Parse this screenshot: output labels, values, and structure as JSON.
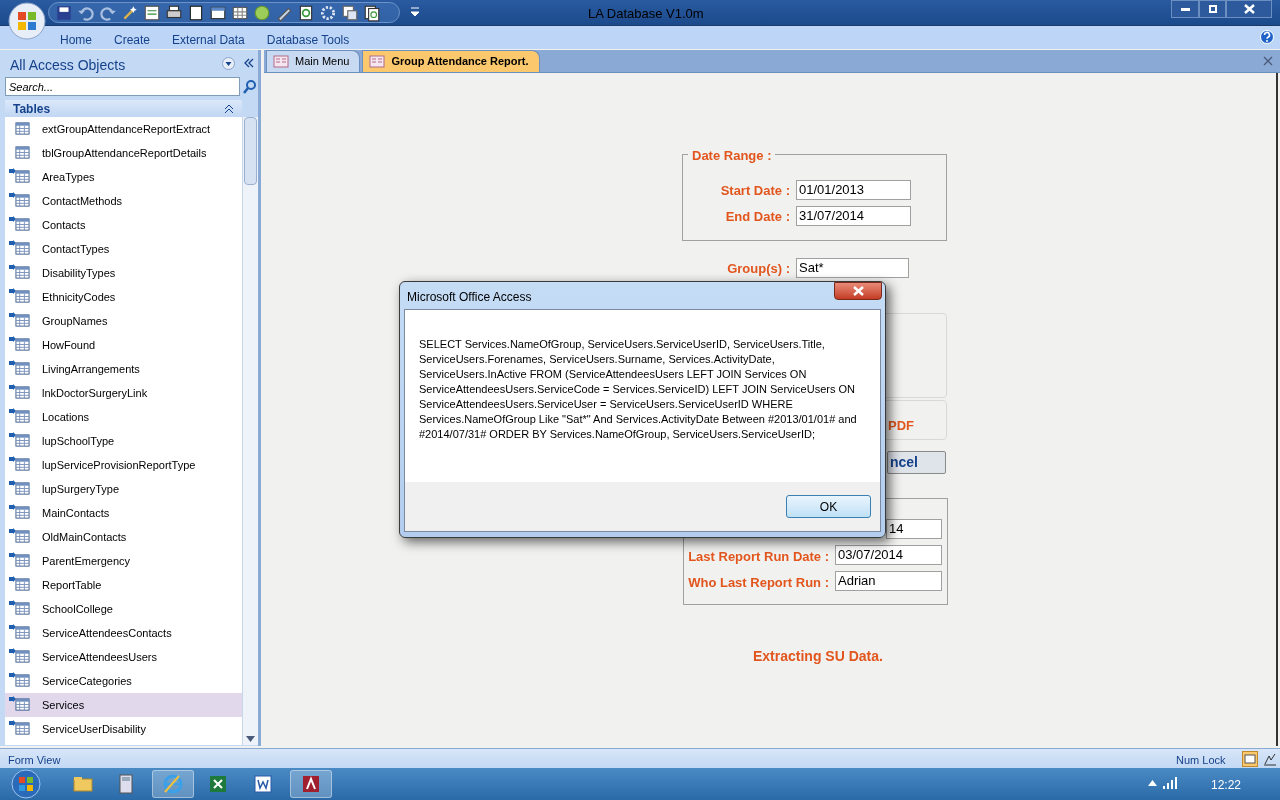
{
  "window": {
    "title": "LA Database V1.0m"
  },
  "ribbon_tabs": [
    "Home",
    "Create",
    "External Data",
    "Database Tools"
  ],
  "nav_pane": {
    "title": "All Access Objects",
    "search": {
      "placeholder": "Search..."
    },
    "group": "Tables",
    "items": [
      {
        "label": "extGroupAttendanceReportExtract",
        "kind": "local",
        "selected": false
      },
      {
        "label": "tblGroupAttendanceReportDetails",
        "kind": "local",
        "selected": false
      },
      {
        "label": "AreaTypes",
        "kind": "linked",
        "selected": false
      },
      {
        "label": "ContactMethods",
        "kind": "linked",
        "selected": false
      },
      {
        "label": "Contacts",
        "kind": "linked",
        "selected": false
      },
      {
        "label": "ContactTypes",
        "kind": "linked",
        "selected": false
      },
      {
        "label": "DisabilityTypes",
        "kind": "linked",
        "selected": false
      },
      {
        "label": "EthnicityCodes",
        "kind": "linked",
        "selected": false
      },
      {
        "label": "GroupNames",
        "kind": "linked",
        "selected": false
      },
      {
        "label": "HowFound",
        "kind": "linked",
        "selected": false
      },
      {
        "label": "LivingArrangements",
        "kind": "linked",
        "selected": false
      },
      {
        "label": "lnkDoctorSurgeryLink",
        "kind": "linked",
        "selected": false
      },
      {
        "label": "Locations",
        "kind": "linked",
        "selected": false
      },
      {
        "label": "lupSchoolType",
        "kind": "linked",
        "selected": false
      },
      {
        "label": "lupServiceProvisionReportType",
        "kind": "linked",
        "selected": false
      },
      {
        "label": "lupSurgeryType",
        "kind": "linked",
        "selected": false
      },
      {
        "label": "MainContacts",
        "kind": "linked",
        "selected": false
      },
      {
        "label": "OldMainContacts",
        "kind": "linked",
        "selected": false
      },
      {
        "label": "ParentEmergency",
        "kind": "linked",
        "selected": false
      },
      {
        "label": "ReportTable",
        "kind": "linked",
        "selected": false
      },
      {
        "label": "SchoolCollege",
        "kind": "linked",
        "selected": false
      },
      {
        "label": "ServiceAttendeesContacts",
        "kind": "linked",
        "selected": false
      },
      {
        "label": "ServiceAttendeesUsers",
        "kind": "linked",
        "selected": false
      },
      {
        "label": "ServiceCategories",
        "kind": "linked",
        "selected": false
      },
      {
        "label": "Services",
        "kind": "linked",
        "selected": true
      },
      {
        "label": "ServiceUserDisability",
        "kind": "linked",
        "selected": false
      }
    ]
  },
  "doc_tabs": [
    {
      "label": "Main Menu",
      "selected": false
    },
    {
      "label": "Group Attendance Report.",
      "selected": true
    }
  ],
  "form": {
    "date_range": {
      "legend": "Date Range :",
      "start_label": "Start Date :",
      "start_value": "01/01/2013",
      "end_label": "End Date :",
      "end_value": "31/07/2014"
    },
    "groups_label": "Group(s) :",
    "groups_value": "Sat*",
    "pdf_text": "PDF",
    "cancel_button": "ncel",
    "last_run": {
      "field_1_value": "14",
      "date_label": "Last Report Run Date :",
      "date_value": "03/07/2014",
      "who_label": "Who Last Report Run :",
      "who_value": "Adrian"
    },
    "status_message": "Extracting SU Data."
  },
  "dialog": {
    "title": "Microsoft Office Access",
    "message": "SELECT Services.NameOfGroup, ServiceUsers.ServiceUserID, ServiceUsers.Title, ServiceUsers.Forenames, ServiceUsers.Surname, Services.ActivityDate, ServiceUsers.InActive FROM (ServiceAttendeesUsers LEFT JOIN Services ON ServiceAttendeesUsers.ServiceCode = Services.ServiceID) LEFT JOIN ServiceUsers ON ServiceAttendeesUsers.ServiceUser = ServiceUsers.ServiceUserID WHERE Services.NameOfGroup Like \"Sat*\" And Services.ActivityDate Between #2013/01/01# and #2014/07/31# ORDER BY Services.NameOfGroup, ServiceUsers.ServiceUserID;",
    "ok_button": "OK"
  },
  "status_bar": {
    "left": "Form View",
    "right": "Num Lock"
  },
  "taskbar": {
    "clock": "12:22"
  }
}
